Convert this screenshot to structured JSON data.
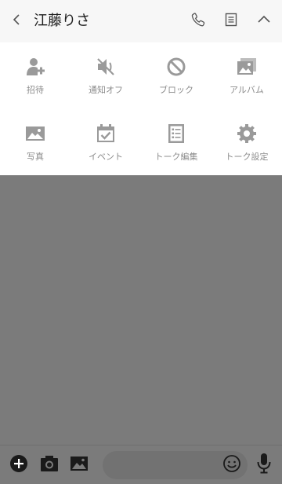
{
  "header": {
    "title": "江藤りさ",
    "icons": [
      "back-icon",
      "phone-icon",
      "note-icon",
      "chevron-up-icon"
    ]
  },
  "menu": {
    "items": [
      {
        "label": "招待",
        "icon": "invite-icon"
      },
      {
        "label": "通知オフ",
        "icon": "notification-off-icon"
      },
      {
        "label": "ブロック",
        "icon": "block-icon"
      },
      {
        "label": "アルバム",
        "icon": "album-icon"
      },
      {
        "label": "写真",
        "icon": "photo-icon"
      },
      {
        "label": "イベント",
        "icon": "event-icon"
      },
      {
        "label": "トーク編集",
        "icon": "edit-chat-icon"
      },
      {
        "label": "トーク設定",
        "icon": "chat-settings-icon"
      }
    ]
  },
  "composer": {
    "message_value": "",
    "icons": [
      "add-icon",
      "camera-icon",
      "image-icon",
      "emoji-icon",
      "microphone-icon"
    ]
  },
  "colors": {
    "header_bg": "#f7f7f7",
    "menu_bg": "#ffffff",
    "chat_bg": "#7b7b7b",
    "icon_gray": "#9a9a9a",
    "label_gray": "#8c8c8c"
  }
}
